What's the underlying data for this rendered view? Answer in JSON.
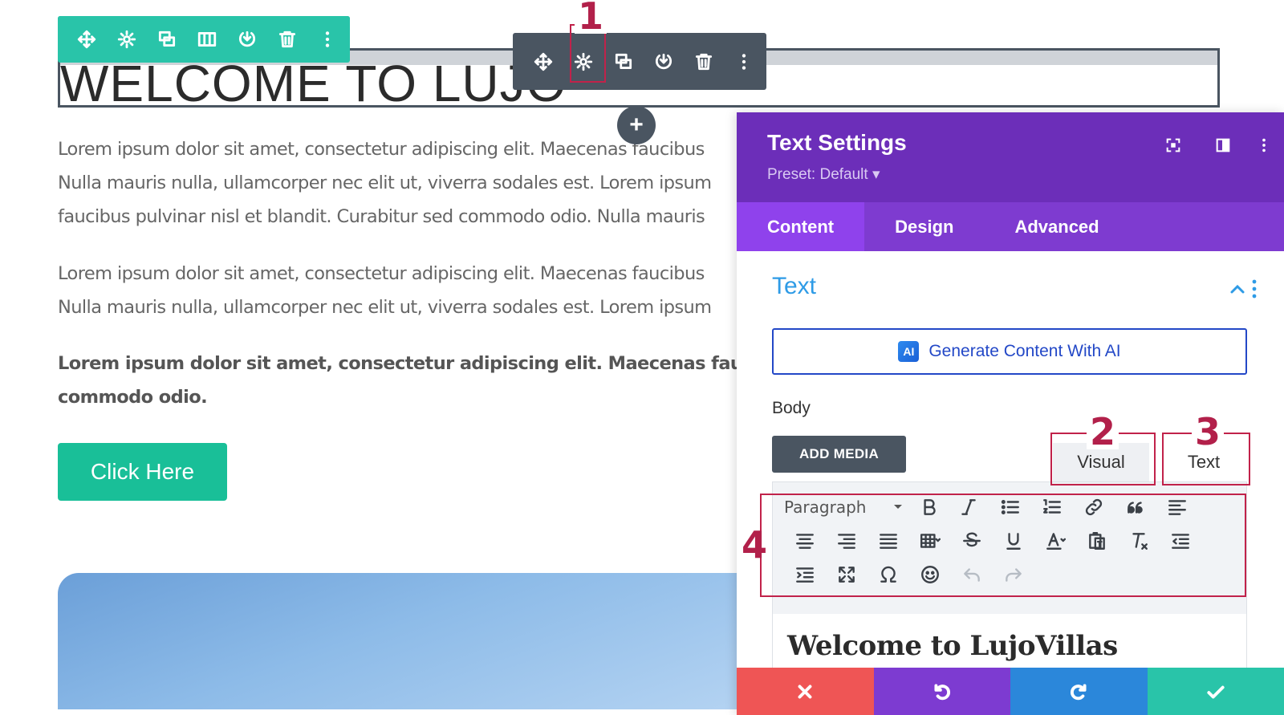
{
  "section_toolbar": {
    "icons": [
      "move-icon",
      "gear-icon",
      "duplicate-icon",
      "columns-icon",
      "save-icon",
      "trash-icon",
      "more-icon"
    ]
  },
  "heading": {
    "text": "WELCOME TO LUJO"
  },
  "module_toolbar": {
    "icons": [
      "move-icon",
      "gear-icon",
      "duplicate-icon",
      "save-icon",
      "trash-icon",
      "more-icon"
    ]
  },
  "add_button": {
    "label": "+"
  },
  "body": {
    "paragraphs": [
      {
        "lines": [
          "Lorem ipsum dolor sit amet, consectetur adipiscing elit. Maecenas faucibus",
          "Nulla mauris nulla, ullamcorper nec elit ut, viverra sodales est. Lorem ipsum",
          "faucibus pulvinar nisl et blandit. Curabitur sed commodo odio. Nulla mauris"
        ]
      },
      {
        "lines": [
          "Lorem ipsum dolor sit amet, consectetur adipiscing elit. Maecenas faucibus",
          "Nulla mauris nulla, ullamcorper nec elit ut, viverra sodales est. Lorem ipsum"
        ]
      },
      {
        "lines": [
          "Lorem ipsum dolor sit amet, consectetur adipiscing elit. Maecenas faucil",
          "commodo odio."
        ]
      }
    ],
    "cta_label": "Click Here"
  },
  "panel": {
    "title": "Text Settings",
    "preset": "Preset: Default ▾",
    "tabs": [
      {
        "label": "Content",
        "active": true
      },
      {
        "label": "Design",
        "active": false
      },
      {
        "label": "Advanced",
        "active": false
      }
    ],
    "section_title": "Text",
    "ai_button_label": "Generate Content With AI",
    "ai_badge": "AI",
    "body_label": "Body",
    "add_media_label": "ADD MEDIA",
    "editor_tabs": {
      "visual": "Visual",
      "text": "Text"
    },
    "format_select": "Paragraph",
    "editor_heading": "Welcome to LujoVillas"
  },
  "footer": {
    "buttons": [
      {
        "name": "discard",
        "color": "#ef5555"
      },
      {
        "name": "undo",
        "color": "#7d3bd1"
      },
      {
        "name": "redo",
        "color": "#2b87da"
      },
      {
        "name": "save",
        "color": "#29c4a9"
      }
    ]
  },
  "annotations": {
    "n1": "1",
    "n2": "2",
    "n3": "3",
    "n4": "4"
  },
  "colors": {
    "section_toolbar": "#29c4a9",
    "module_toolbar": "#4a5561",
    "panel_header": "#6c2eb9",
    "panel_tabs": "#7e3bd0",
    "accent_blue": "#2e9be6",
    "cta": "#19bf98",
    "annotation": "#b2204a"
  }
}
